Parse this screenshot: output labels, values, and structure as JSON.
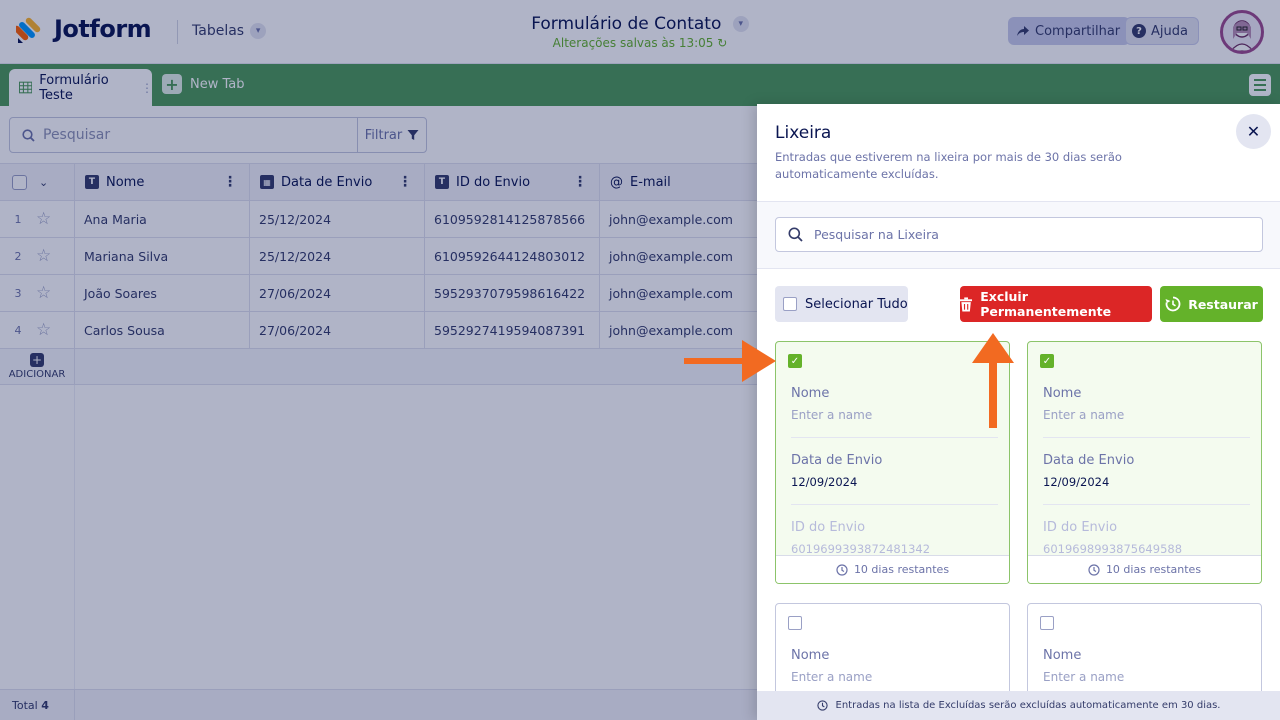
{
  "header": {
    "logo_text": "Jotform",
    "section": "Tabelas",
    "form_title": "Formulário de Contato",
    "saved_status": "Alterações salvas às 13:05",
    "share_label": "Compartilhar",
    "help_label": "Ajuda"
  },
  "tabs": {
    "active": "Formulário Teste",
    "new_tab": "New Tab"
  },
  "toolbar": {
    "search_placeholder": "Pesquisar",
    "filter_label": "Filtrar"
  },
  "table": {
    "columns": [
      "Nome",
      "Data de Envio",
      "ID do Envio",
      "E-mail"
    ],
    "rows": [
      {
        "n": "1",
        "nome": "Ana Maria",
        "data": "25/12/2024",
        "id": "6109592814125878566",
        "email": "john@example.com"
      },
      {
        "n": "2",
        "nome": "Mariana Silva",
        "data": "25/12/2024",
        "id": "6109592644124803012",
        "email": "john@example.com"
      },
      {
        "n": "3",
        "nome": "João Soares",
        "data": "27/06/2024",
        "id": "5952937079598616422",
        "email": "john@example.com"
      },
      {
        "n": "4",
        "nome": "Carlos Sousa",
        "data": "27/06/2024",
        "id": "5952927419594087391",
        "email": "john@example.com"
      }
    ],
    "add_label": "ADICIONAR",
    "total_label": "Total",
    "total_value": "4"
  },
  "trash": {
    "title": "Lixeira",
    "subtitle": "Entradas que estiverem na lixeira por mais de 30 dias serão automaticamente excluídas.",
    "search_placeholder": "Pesquisar na Lixeira",
    "select_all": "Selecionar Tudo",
    "delete_label": "Excluir Permanentemente",
    "restore_label": "Restaurar",
    "cards": [
      {
        "selected": true,
        "nome_label": "Nome",
        "nome_ph": "Enter a name",
        "data_label": "Data de Envio",
        "data_value": "12/09/2024",
        "id_label": "ID do Envio",
        "id_value": "6019699393872481342",
        "remaining": "10 dias restantes"
      },
      {
        "selected": true,
        "nome_label": "Nome",
        "nome_ph": "Enter a name",
        "data_label": "Data de Envio",
        "data_value": "12/09/2024",
        "id_label": "ID do Envio",
        "id_value": "6019698993875649588",
        "remaining": "10 dias restantes"
      },
      {
        "selected": false,
        "nome_label": "Nome",
        "nome_ph": "Enter a name"
      },
      {
        "selected": false,
        "nome_label": "Nome",
        "nome_ph": "Enter a name"
      }
    ],
    "footer_note": "Entradas na lista de Excluídas serão excluídas automaticamente em 30 dias."
  },
  "colors": {
    "brand_navy": "#0a1551",
    "tab_green": "#4d9a57",
    "delete_red": "#dc2626",
    "restore_green": "#64b22a",
    "arrow_orange": "#f26a21"
  }
}
